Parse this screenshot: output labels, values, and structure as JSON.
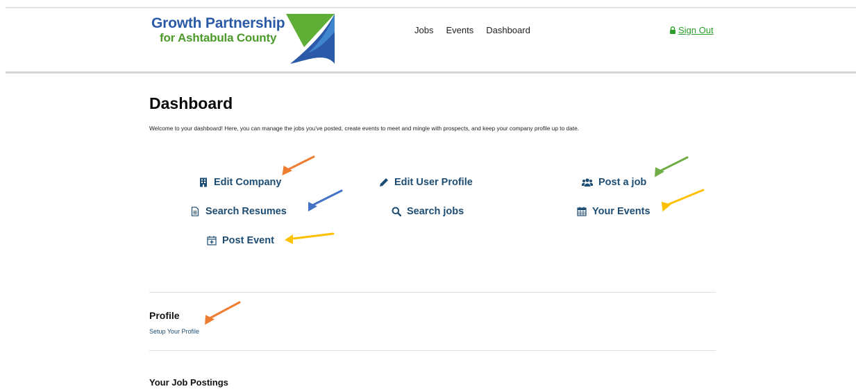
{
  "header": {
    "logo": {
      "line1": "Growth Partnership",
      "line2": "for Ashtabula County"
    },
    "nav": [
      "Jobs",
      "Events",
      "Dashboard"
    ],
    "signout_label": "Sign Out"
  },
  "dashboard": {
    "title": "Dashboard",
    "intro": "Welcome to your dashboard! Here, you can manage the jobs you've posted, create events to meet and mingle with prospects, and keep your company profile up to date.",
    "actions": {
      "edit_company": "Edit Company",
      "edit_user_profile": "Edit User Profile",
      "post_job": "Post a job",
      "search_resumes": "Search Resumes",
      "search_jobs": "Search jobs",
      "your_events": "Your Events",
      "post_event": "Post Event"
    }
  },
  "profile": {
    "title": "Profile",
    "link": "Setup Your Profile"
  },
  "job_postings": {
    "title": "Your Job Postings"
  },
  "colors": {
    "link": "#1e4d73",
    "signout": "#2a9d2a",
    "arrow_orange": "#ed7d31",
    "arrow_blue": "#4472c4",
    "arrow_green": "#70ad47",
    "arrow_yellow": "#ffc000"
  },
  "icons": {
    "edit_company": "building-icon",
    "edit_user_profile": "pencil-icon",
    "post_job": "users-icon",
    "search_resumes": "document-icon",
    "search_jobs": "search-icon",
    "your_events": "calendar-icon",
    "post_event": "calendar-plus-icon",
    "signout": "lock-icon"
  }
}
